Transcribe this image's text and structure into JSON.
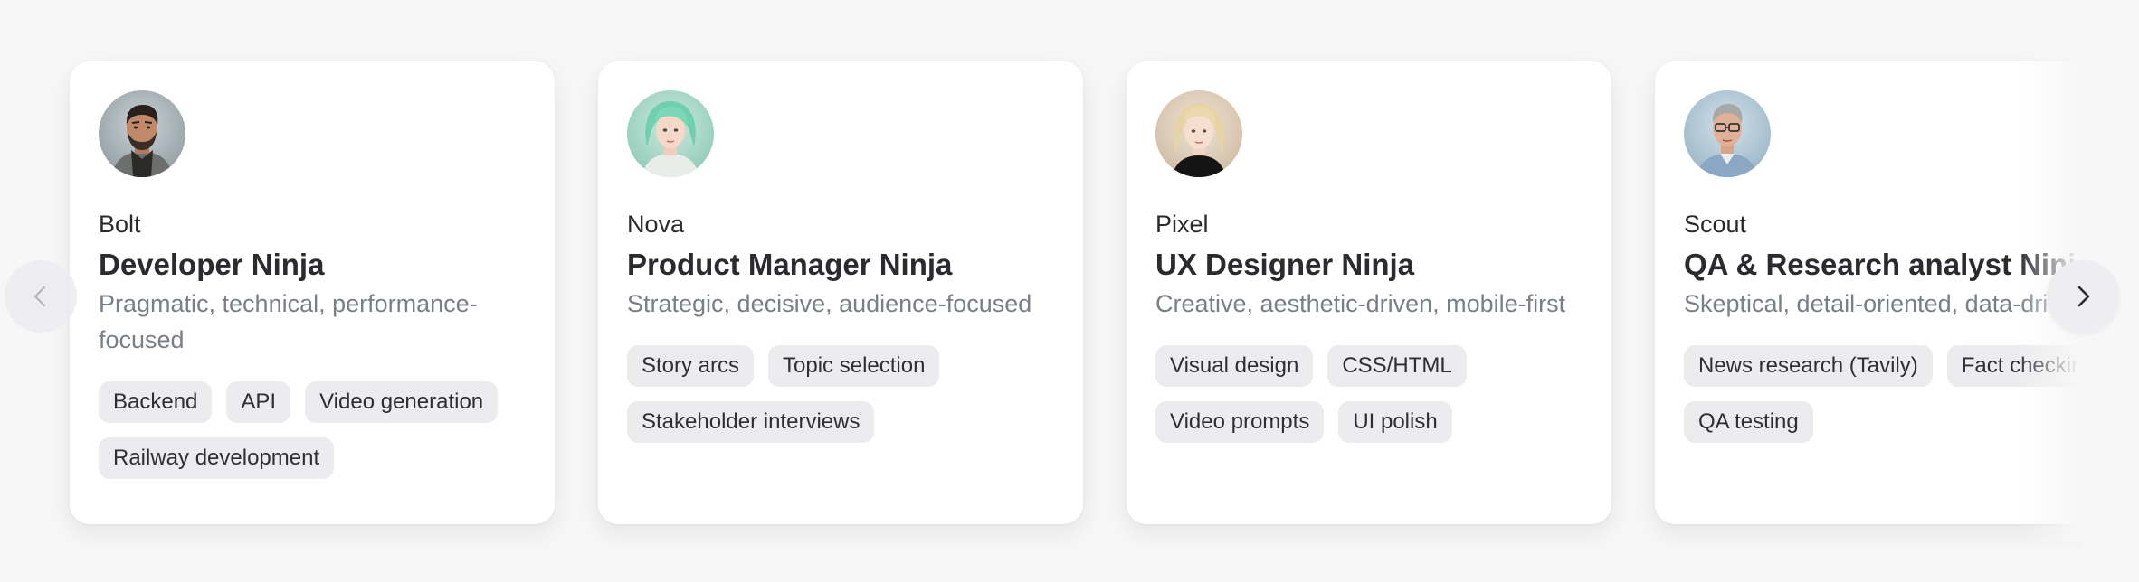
{
  "carousel": {
    "prev_icon": "chevron-left-icon",
    "next_icon": "chevron-right-icon",
    "cards": [
      {
        "name": "Bolt",
        "role": "Developer Ninja",
        "description": "Pragmatic, technical, performance-focused",
        "tags": [
          "Backend",
          "API",
          "Video generation",
          "Railway development"
        ]
      },
      {
        "name": "Nova",
        "role": "Product Manager Ninja",
        "description": "Strategic, decisive, audience-focused",
        "tags": [
          "Story arcs",
          "Topic selection",
          "Stakeholder interviews"
        ]
      },
      {
        "name": "Pixel",
        "role": "UX Designer Ninja",
        "description": "Creative, aesthetic-driven, mobile-first",
        "tags": [
          "Visual design",
          "CSS/HTML",
          "Video prompts",
          "UI polish"
        ]
      },
      {
        "name": "Scout",
        "role": "QA & Research analyst Ninja",
        "description": "Skeptical, detail-oriented, data-driven",
        "tags": [
          "News research (Tavily)",
          "Fact checking",
          "QA testing"
        ]
      }
    ]
  }
}
